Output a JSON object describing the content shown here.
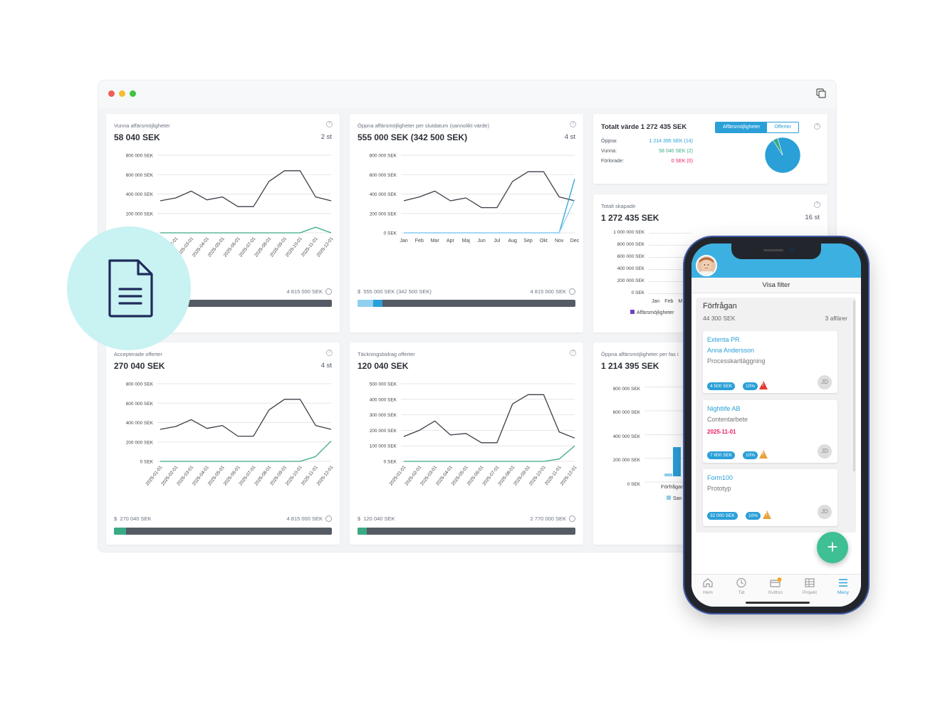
{
  "window": {
    "cards": {
      "won": {
        "title": "Vunna affärsmöjligheter",
        "value": "58 040 SEK",
        "count": "2 st",
        "foot_right": "4 815 000 SEK"
      },
      "open_by_date": {
        "title": "Öppna affärsmöjligheter per slutdatum (sannolikt värde)",
        "value": "555 000 SEK (342 500 SEK)",
        "count": "4 st",
        "foot_left": "555 000 SEK (342 500 SEK)",
        "foot_right": "4 815 000 SEK"
      },
      "total_value": {
        "title": "Totalt värde 1 272 435 SEK",
        "tab_1": "Affärsmöjligheter",
        "tab_2": "Offerter",
        "rows": [
          {
            "label": "Öppna:",
            "value": "1 214 395 SEK (14)",
            "color": "#2a9fd8"
          },
          {
            "label": "Vunna:",
            "value": "58 040 SEK (2)",
            "color": "#3aaa85"
          },
          {
            "label": "Förlorade:",
            "value": "0 SEK (0)",
            "color": "#e91e63"
          }
        ]
      },
      "total_created": {
        "title": "Totalt skapade",
        "value": "1 272 435 SEK",
        "count": "16 st",
        "legend": "Affärsmöjligheter",
        "ticks": [
          "1 000 000 SEK",
          "800 000 SEK",
          "600 000 SEK",
          "400 000 SEK",
          "200 000 SEK",
          "0 SEK"
        ],
        "months": [
          "Jan",
          "Feb",
          "M"
        ]
      },
      "accepted": {
        "title": "Accepterade offerter",
        "value": "270 040 SEK",
        "count": "4 st",
        "foot_left": "270 040 SEK",
        "foot_right": "4 815 000 SEK"
      },
      "margin": {
        "title": "Täckningsbidrag offerter",
        "value": "120 040 SEK",
        "foot_left": "120 040 SEK",
        "foot_right": "2 770 000 SEK"
      },
      "open_by_phase": {
        "title": "Öppna affärsmöjligheter per fas i",
        "value": "1 214 395 SEK",
        "ticks": [
          "800 000 SEK",
          "600 000 SEK",
          "400 000 SEK",
          "200 000 SEK",
          "0 SEK"
        ],
        "category": "Förfrågan",
        "legend": "San"
      }
    }
  },
  "phone": {
    "filter_label": "Visa filter",
    "column": {
      "title": "Förfrågan",
      "sum": "44 300 SEK",
      "count": "3 affärer"
    },
    "deals": [
      {
        "company": "Extenta PR",
        "contact": "Anna Andersson",
        "description": "Processkartläggning",
        "amount": "4 500 SEK",
        "probability": "10%",
        "initials": "JD",
        "warning": "danger"
      },
      {
        "company": "Nightlife AB",
        "description": "Contentarbete",
        "date": "2025-11-01",
        "amount": "7 800 SEK",
        "probability": "10%",
        "initials": "JD",
        "warning": "caution"
      },
      {
        "company": "Form100",
        "description": "Prototyp",
        "amount": "32 000 SEK",
        "probability": "10%",
        "initials": "JD",
        "warning": "caution"
      }
    ],
    "fab_label": "+",
    "tabs": [
      {
        "label": "Hem",
        "icon": "home-icon"
      },
      {
        "label": "Tid",
        "icon": "clock-icon"
      },
      {
        "label": "Kvitton",
        "icon": "receipt-icon"
      },
      {
        "label": "Projekt",
        "icon": "table-icon"
      },
      {
        "label": "Meny",
        "icon": "menu-icon"
      }
    ]
  },
  "colors": {
    "accent": "#2a9fd8",
    "green": "#3aaa85",
    "line": "#3a3f47",
    "danger": "#e53935",
    "caution": "#e8a23c"
  },
  "chart_data": [
    {
      "type": "line",
      "title": "Vunna affärsmöjligheter",
      "x": [
        "2025-01-01",
        "2025-02-01",
        "2025-03-01",
        "2025-04-01",
        "2025-05-01",
        "2025-06-01",
        "2025-07-01",
        "2025-08-01",
        "2025-09-01",
        "2025-10-01",
        "2025-11-01",
        "2025-12-01"
      ],
      "yticks": [
        "800 000 SEK",
        "600 000 SEK",
        "400 000 SEK",
        "200 000 SEK",
        "0 SEK"
      ],
      "ylim": [
        0,
        800000
      ],
      "series": [
        {
          "values": [
            330000,
            360000,
            430000,
            340000,
            370000,
            270000,
            270000,
            530000,
            640000,
            640000,
            370000,
            330000
          ],
          "color": "#3a3f47"
        },
        {
          "values": [
            0,
            0,
            0,
            0,
            0,
            0,
            0,
            0,
            0,
            0,
            58040,
            0
          ],
          "color": "#3aaa85"
        }
      ]
    },
    {
      "type": "line",
      "title": "Öppna affärsmöjligheter per slutdatum (sannolikt värde)",
      "x": [
        "Jan",
        "Feb",
        "Mar",
        "Apr",
        "Maj",
        "Jun",
        "Jul",
        "Aug",
        "Sep",
        "Okt",
        "Nov",
        "Dec"
      ],
      "yticks": [
        "800 000 SEK",
        "600 000 SEK",
        "400 000 SEK",
        "200 000 SEK",
        "0 SEK"
      ],
      "ylim": [
        0,
        800000
      ],
      "series": [
        {
          "values": [
            330000,
            370000,
            430000,
            330000,
            360000,
            260000,
            260000,
            530000,
            630000,
            630000,
            370000,
            330000
          ],
          "color": "#3a3f47"
        },
        {
          "values": [
            0,
            0,
            0,
            0,
            0,
            0,
            0,
            0,
            0,
            0,
            0,
            555000
          ],
          "color": "#2a9fd8"
        },
        {
          "values": [
            0,
            0,
            0,
            0,
            0,
            0,
            0,
            0,
            0,
            0,
            0,
            342500
          ],
          "color": "#8fd0f0"
        }
      ]
    },
    {
      "type": "line",
      "title": "Accepterade offerter",
      "x": [
        "2025-01-01",
        "2025-02-01",
        "2025-03-01",
        "2025-04-01",
        "2025-05-01",
        "2025-06-01",
        "2025-07-01",
        "2025-08-01",
        "2025-09-01",
        "2025-10-01",
        "2025-11-01",
        "2025-12-01"
      ],
      "yticks": [
        "800 000 SEK",
        "600 000 SEK",
        "400 000 SEK",
        "200 000 SEK",
        "0 SEK"
      ],
      "ylim": [
        0,
        800000
      ],
      "series": [
        {
          "values": [
            330000,
            360000,
            430000,
            340000,
            370000,
            260000,
            260000,
            530000,
            640000,
            640000,
            370000,
            330000
          ],
          "color": "#3a3f47"
        },
        {
          "values": [
            0,
            0,
            0,
            0,
            0,
            0,
            0,
            0,
            0,
            0,
            50000,
            210000
          ],
          "color": "#3aaa85"
        }
      ]
    },
    {
      "type": "line",
      "title": "Täckningsbidrag offerter",
      "x": [
        "2025-01-01",
        "2025-02-01",
        "2025-03-01",
        "2025-04-01",
        "2025-05-01",
        "2025-06-01",
        "2025-07-01",
        "2025-08-01",
        "2025-09-01",
        "2025-10-01",
        "2025-11-01",
        "2025-12-01"
      ],
      "yticks": [
        "500 000 SEK",
        "400 000 SEK",
        "300 000 SEK",
        "200 000 SEK",
        "100 000 SEK",
        "0 SEK"
      ],
      "ylim": [
        0,
        500000
      ],
      "series": [
        {
          "values": [
            160000,
            200000,
            260000,
            170000,
            180000,
            120000,
            120000,
            370000,
            430000,
            430000,
            190000,
            150000
          ],
          "color": "#3a3f47"
        },
        {
          "values": [
            0,
            0,
            0,
            0,
            0,
            0,
            0,
            0,
            0,
            0,
            15000,
            100000
          ],
          "color": "#3aaa85"
        }
      ]
    },
    {
      "type": "pie",
      "title": "Totalt värde 1 272 435 SEK",
      "labels": [
        "Öppna",
        "Vunna",
        "Förlorade"
      ],
      "values": [
        1214395,
        58040,
        0
      ]
    }
  ]
}
